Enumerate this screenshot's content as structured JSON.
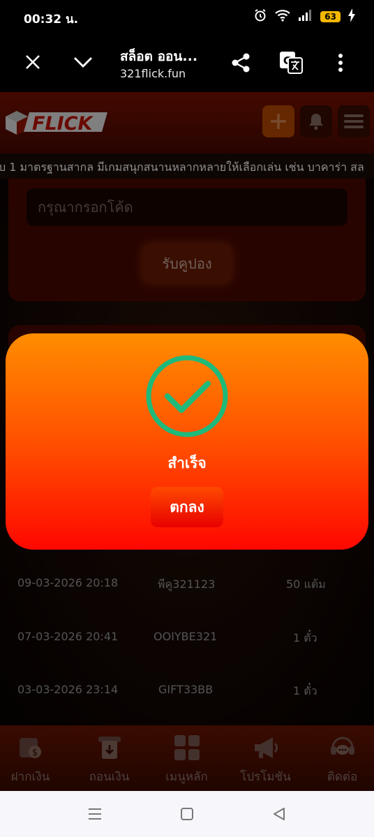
{
  "status_bar": {
    "time": "00:32 น.",
    "battery": "63"
  },
  "browser": {
    "title": "สล็อต ออน...",
    "url": "321flick.fun"
  },
  "site": {
    "logo_text": "FLICK",
    "marquee": "บ 1 มาตรฐานสากล มีเกมสนุกสนานหลากหลายให้เลือกเล่น เช่น บาคาร่า สล"
  },
  "coupon": {
    "input_placeholder": "กรุณากรอกโค้ด",
    "claim_label": "รับคูปอง"
  },
  "history": [
    {
      "date": "09-03-2026 20:18",
      "code": "พีคู321123",
      "reward": "50 แต้ม"
    },
    {
      "date": "07-03-2026 20:41",
      "code": "OOIYBE321",
      "reward": "1 ตั๋ว"
    },
    {
      "date": "03-03-2026 23:14",
      "code": "GIFT33BB",
      "reward": "1 ตั๋ว"
    }
  ],
  "modal": {
    "message": "สำเร็จ",
    "ok_label": "ตกลง",
    "icon": "check-circle-icon",
    "icon_color": "#1fb97a"
  },
  "bottom_nav": [
    {
      "label": "ฝากเงิน",
      "icon": "deposit-icon"
    },
    {
      "label": "ถอนเงิน",
      "icon": "withdraw-icon"
    },
    {
      "label": "เมนูหลัก",
      "icon": "grid-icon"
    },
    {
      "label": "โปรโมชัน",
      "icon": "megaphone-icon"
    },
    {
      "label": "ติดต่อ",
      "icon": "support-icon"
    }
  ],
  "colors": {
    "accent": "#ff8d00",
    "modal_bottom": "#ff0700",
    "header": "#7a1200"
  }
}
